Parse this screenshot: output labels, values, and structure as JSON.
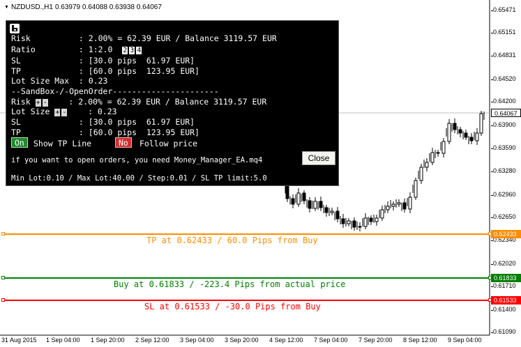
{
  "chart": {
    "symbol": "NZDUSD.,H1",
    "ohlc": "0.63979 0.64088 0.63938 0.64067",
    "current_price": "0.64067",
    "price_ticks": [
      "0.65471",
      "0.65151",
      "0.64831",
      "0.64520",
      "0.64200",
      "0.63900",
      "0.63590",
      "0.63280",
      "0.62960",
      "0.62650",
      "0.62340",
      "0.62020",
      "0.61710",
      "0.61400",
      "0.61090"
    ],
    "time_ticks": [
      "31 Aug 2015",
      "1 Sep 04:00",
      "1 Sep 20:00",
      "2 Sep 12:00",
      "3 Sep 04:00",
      "3 Sep 20:00",
      "4 Sep 12:00",
      "7 Sep 04:00",
      "7 Sep 20:00",
      "8 Sep 12:00",
      "9 Sep 04:00"
    ]
  },
  "lines": {
    "tp": {
      "price": "0.62433",
      "caption": "TP at 0.62433 / 60.0 Pips from Buy",
      "color": "#ff8c00"
    },
    "buy": {
      "price": "0.61833",
      "caption": "Buy at 0.61833 / -223.4 Pips from actual price",
      "color": "#008000"
    },
    "sl": {
      "price": "0.61533",
      "caption": "SL at 0.61533 / -30.0 Pips from Buy",
      "color": "#ff0000"
    }
  },
  "panel": {
    "row1": "Risk          : 2.00% = 62.39 EUR / Balance 3119.57 EUR",
    "ratio_label": "Ratio         : 1:2.0  ",
    "ratio_buttons": [
      "2",
      "3",
      "4"
    ],
    "row3": "SL            : [30.0 pips  61.97 EUR]",
    "row4": "TP            : [60.0 pips  123.95 EUR]",
    "row5": "Lot Size Max  : 0.23",
    "row6": "--SandBox-/-OpenOrder----------------------",
    "risk_label": "Risk ",
    "risk_value": "    : 2.00% = 62.39 EUR / Balance 3119.57 EUR",
    "lot_label": "Lot Size ",
    "lot_value": "    : 0.23",
    "row9": "SL            : [30.0 pips  61.97 EUR]",
    "row10": "TP            : [60.0 pips  123.95 EUR]",
    "plus": "+",
    "minus": "-",
    "toggle_on": "On",
    "toggle_on_text": "Show TP Line",
    "toggle_off": "No",
    "toggle_off_text": "Follow price",
    "note": "if you want to open orders, you need Money_Manager_EA.mq4",
    "close": "Close",
    "footer": "Min Lot:0.10 / Max Lot:40.00 / Step:0.01 / SL TP limit:5.0"
  }
}
